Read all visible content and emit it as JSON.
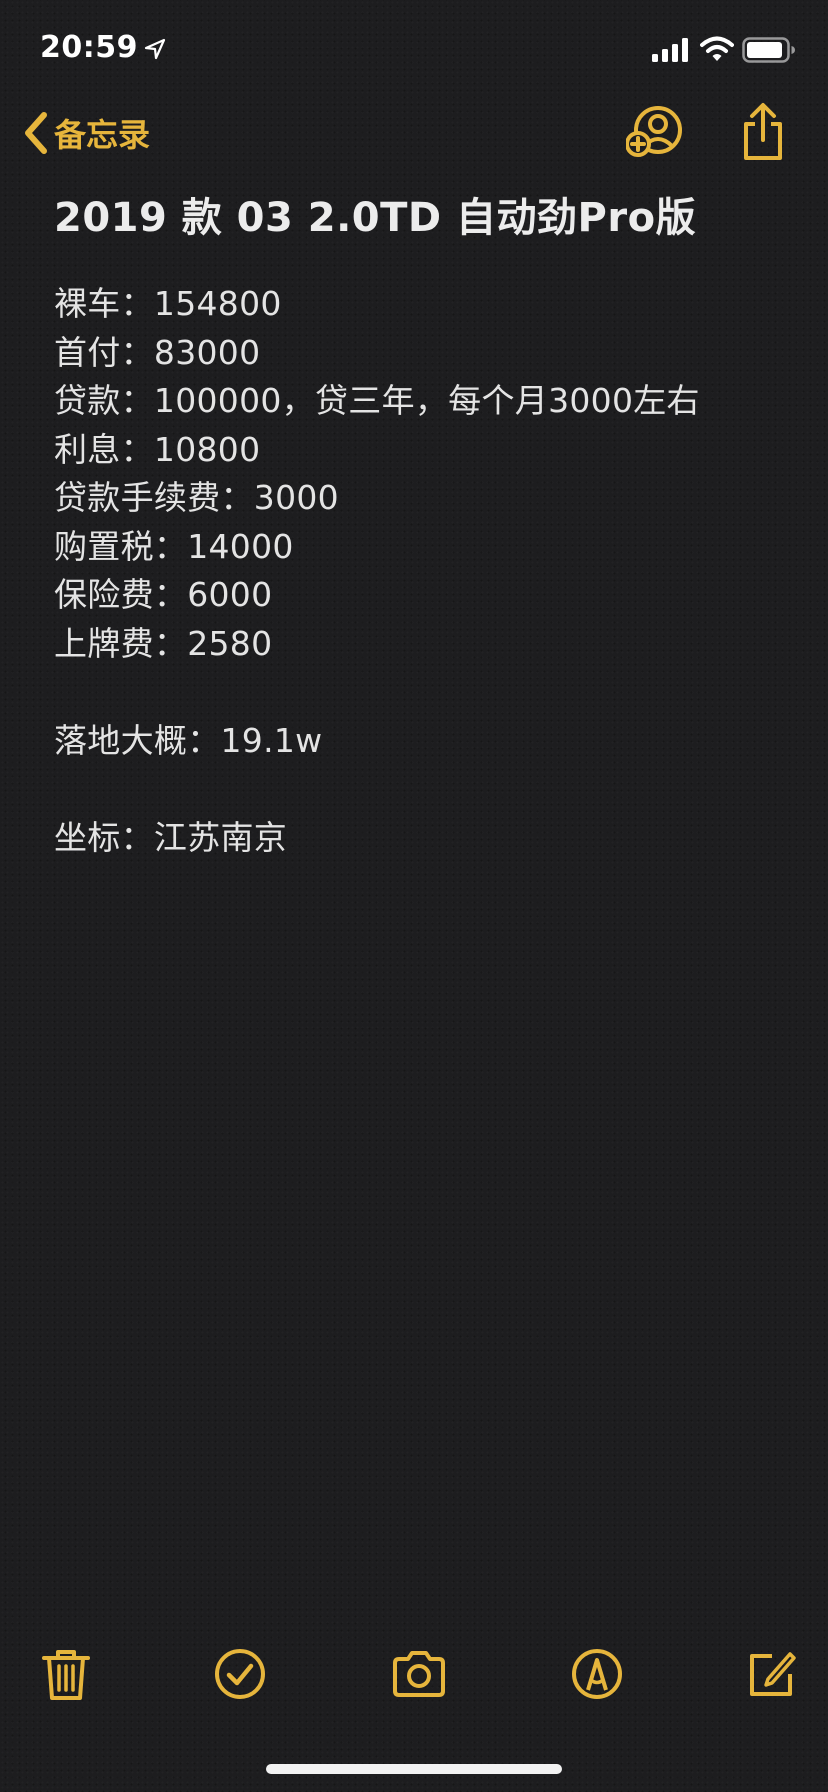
{
  "status_bar": {
    "time": "20:59"
  },
  "nav": {
    "back_label": "备忘录"
  },
  "note": {
    "title": "2019 款 03 2.0TD 自动劲Pro版",
    "lines": [
      "裸车：154800",
      "首付：83000",
      "贷款：100000，贷三年，每个月3000左右",
      "利息：10800",
      "贷款手续费：3000",
      "购置税：14000",
      "保险费：6000",
      "上牌费：2580",
      "",
      "落地大概：19.1w",
      "",
      "坐标：江苏南京"
    ]
  },
  "icons": {
    "location": "location-arrow-icon",
    "signal": "cellular-signal-icon",
    "wifi": "wifi-icon",
    "battery": "battery-icon",
    "back": "chevron-left-icon",
    "collaborate": "add-person-icon",
    "share": "share-icon",
    "trash": "trash-icon",
    "checklist": "checkmark-circle-icon",
    "camera": "camera-icon",
    "markup": "markup-pen-icon",
    "compose": "compose-icon"
  },
  "colors": {
    "accent": "#e6b53c",
    "background": "#1d1d1f",
    "text": "#e4e4e4"
  }
}
